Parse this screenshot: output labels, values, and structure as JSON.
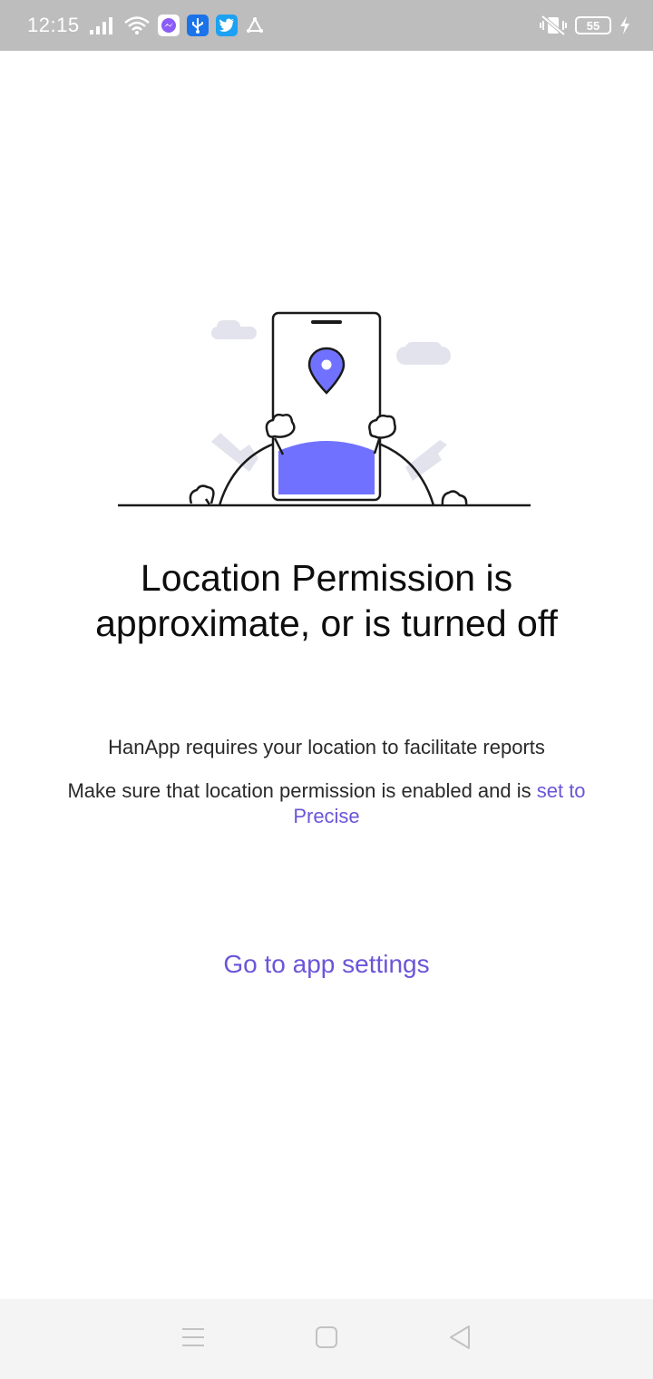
{
  "status_bar": {
    "time": "12:15",
    "battery_level": "55",
    "left_icons": [
      "signal-icon",
      "wifi-icon",
      "messenger-icon",
      "usb-icon",
      "twitter-icon",
      "app-icon"
    ],
    "right_icons": [
      "vibrate-off-icon",
      "battery-icon",
      "charging-icon"
    ]
  },
  "content": {
    "title": "Location Permission is approximate, or is turned off",
    "description_1": "HanApp requires your location to facilitate reports",
    "description_2_prefix": "Make sure that location permission is enabled and is ",
    "description_2_link": "set to Precise",
    "settings_button": "Go to app settings"
  },
  "colors": {
    "accent": "#6a56d9",
    "illustration_fill": "#7072ff",
    "status_bar_bg": "#bdbdbd"
  },
  "nav_bar": {
    "items": [
      "menu-icon",
      "home-icon",
      "back-icon"
    ]
  }
}
